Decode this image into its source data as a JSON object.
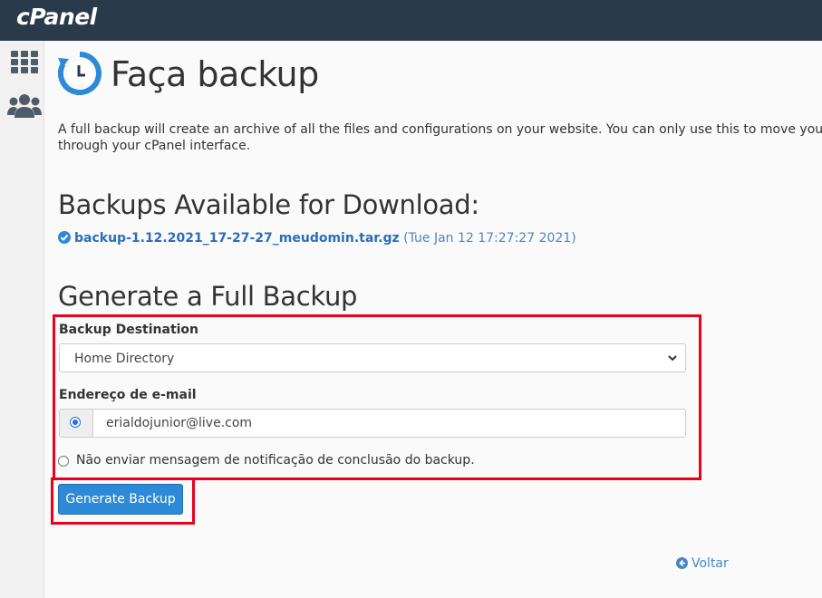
{
  "app": {
    "logo": "cPanel"
  },
  "page": {
    "title": "Faça backup",
    "description_line1": "A full backup will create an archive of all the files and configurations on your website. You can only use this to move your account t",
    "description_line2": "through your cPanel interface."
  },
  "downloads": {
    "heading": "Backups Available for Download:",
    "items": [
      {
        "filename": "backup-1.12.2021_17-27-27_meudomin.tar.gz",
        "date": "(Tue Jan 12 17:27:27 2021)"
      }
    ]
  },
  "generate": {
    "heading": "Generate a Full Backup",
    "destination_label": "Backup Destination",
    "destination_value": "Home Directory",
    "email_label": "Endereço de e-mail",
    "email_value": "erialdojunior@live.com",
    "no_notify_label": "Não enviar mensagem de notificação de conclusão do backup.",
    "button_label": "Generate Backup"
  },
  "footer": {
    "back_label": "Voltar"
  },
  "colors": {
    "topbar": "#293a4a",
    "accent": "#2d8ad6",
    "link": "#2a6ebb",
    "highlight": "#e8001c"
  },
  "icons": [
    "apps-grid-icon",
    "users-icon",
    "backup-clock-icon",
    "check-circle-icon",
    "chevron-down-icon",
    "arrow-left-circle-icon"
  ]
}
